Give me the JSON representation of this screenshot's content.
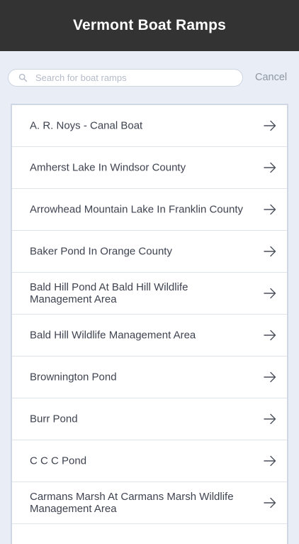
{
  "header": {
    "title": "Vermont Boat Ramps"
  },
  "search": {
    "placeholder": "Search for boat ramps",
    "value": "",
    "cancel_label": "Cancel"
  },
  "list": {
    "items": [
      {
        "label": "A. R. Noys - Canal Boat"
      },
      {
        "label": "Amherst Lake In Windsor County"
      },
      {
        "label": "Arrowhead Mountain Lake In Franklin County"
      },
      {
        "label": "Baker Pond In Orange County"
      },
      {
        "label": "Bald Hill Pond At Bald Hill Wildlife Management Area"
      },
      {
        "label": "Bald Hill Wildlife Management Area"
      },
      {
        "label": "Brownington Pond"
      },
      {
        "label": "Burr Pond"
      },
      {
        "label": "C C C Pond"
      },
      {
        "label": "Carmans Marsh At Carmans Marsh Wildlife Management Area"
      }
    ],
    "item_icon": "arrow-right-icon"
  },
  "colors": {
    "header_bg": "#333333",
    "page_bg": "#e9eef6",
    "text": "#3e4350",
    "cancel": "#8f96a0"
  }
}
